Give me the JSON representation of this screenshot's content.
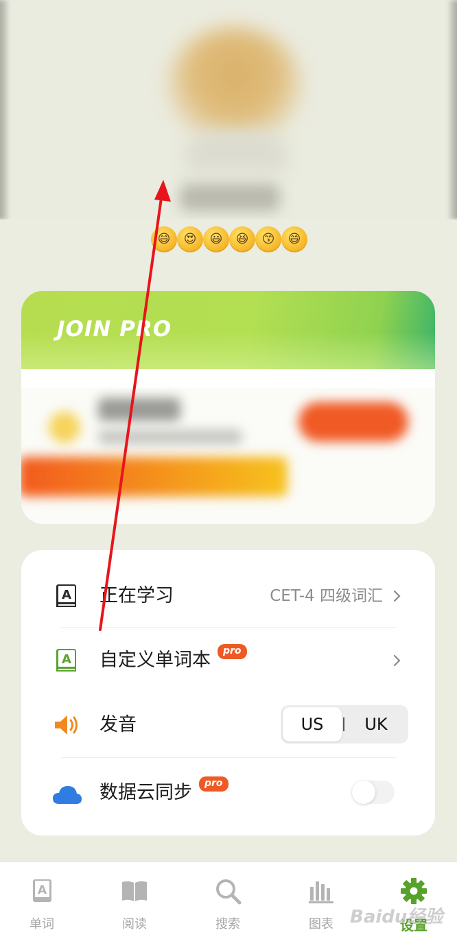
{
  "profile": {
    "emojis": [
      "😄",
      "😍",
      "😃",
      "😆",
      "😙",
      "😄"
    ]
  },
  "pro_card": {
    "title": "JOIN PRO",
    "accent_color": "#b3df53",
    "button_color": "#f05a25"
  },
  "settings": {
    "learning": {
      "label": "正在学习",
      "value": "CET-4 四级词汇",
      "icon": "vocab-book-icon"
    },
    "custom_wordbook": {
      "label": "自定义单词本",
      "badge": "pro",
      "icon": "green-book-icon"
    },
    "pronunciation": {
      "label": "发音",
      "icon": "speaker-icon",
      "options": [
        "US",
        "UK"
      ],
      "selected": "US"
    },
    "cloud_sync": {
      "label": "数据云同步",
      "badge": "pro",
      "icon": "cloud-icon",
      "enabled": false
    }
  },
  "tabs": [
    {
      "label": "单词",
      "icon": "book-a-icon"
    },
    {
      "label": "阅读",
      "icon": "open-book-icon"
    },
    {
      "label": "搜索",
      "icon": "search-icon"
    },
    {
      "label": "图表",
      "icon": "bar-chart-icon"
    },
    {
      "label": "设置",
      "icon": "gear-icon",
      "active": true
    }
  ],
  "watermark": "Baidu经验",
  "colors": {
    "active_tab": "#57a22a",
    "pro_badge": "#ee5a24",
    "annotation_arrow": "#e8141c"
  }
}
